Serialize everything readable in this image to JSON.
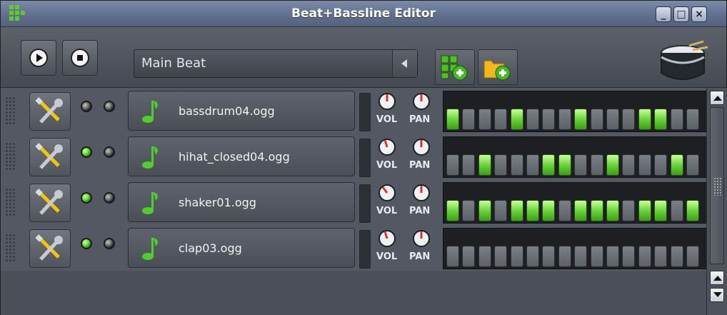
{
  "window": {
    "title": "Beat+Bassline Editor",
    "controls": [
      "minimize",
      "maximize",
      "close"
    ]
  },
  "toolbar": {
    "play_icon": "play-icon",
    "stop_icon": "stop-icon",
    "beat_selector_value": "Main Beat",
    "add_beat_icon": "add-beat-icon",
    "add_bassline_icon": "add-bassline-icon",
    "drum_icon": "drum-icon"
  },
  "labels": {
    "vol": "VOL",
    "pan": "PAN"
  },
  "tracks": [
    {
      "name": "bassdrum04.ogg",
      "led1": "dark",
      "led2": "dark",
      "steps": [
        true,
        false,
        false,
        false,
        true,
        false,
        false,
        false,
        true,
        false,
        false,
        false,
        true,
        true,
        false,
        false
      ]
    },
    {
      "name": "hihat_closed04.ogg",
      "led1": "green",
      "led2": "dark",
      "steps": [
        false,
        false,
        true,
        false,
        false,
        false,
        true,
        true,
        false,
        false,
        true,
        false,
        false,
        false,
        true,
        false
      ]
    },
    {
      "name": "shaker01.ogg",
      "led1": "green",
      "led2": "dark",
      "steps": [
        true,
        false,
        true,
        false,
        true,
        true,
        true,
        false,
        true,
        true,
        true,
        false,
        true,
        true,
        false,
        true
      ]
    },
    {
      "name": "clap03.ogg",
      "led1": "green",
      "led2": "dark",
      "steps": [
        false,
        false,
        false,
        false,
        false,
        false,
        false,
        false,
        false,
        false,
        false,
        false,
        false,
        false,
        false,
        false
      ]
    }
  ],
  "colors": {
    "step_on": "#63cf34",
    "step_off": "#5b5f66",
    "titlebar": "#5f6e8c",
    "background": "#4a4f58"
  }
}
